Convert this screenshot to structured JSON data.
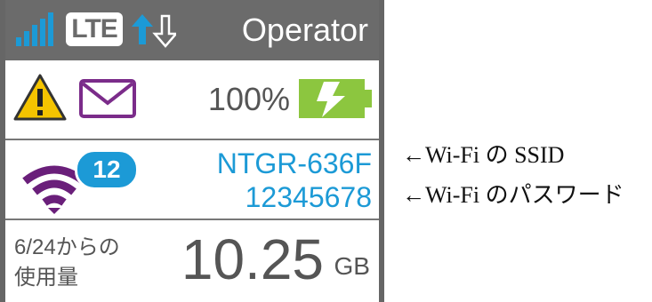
{
  "status_bar": {
    "network_type": "LTE",
    "operator": "Operator",
    "signal_icon": "signal-bars-icon",
    "data_arrows_icon": "up-down-arrows-icon",
    "colors": {
      "background": "#6b6b6b",
      "signal": "#1c9ad6"
    }
  },
  "alerts": {
    "warning_icon": "warning-icon",
    "message_icon": "mail-icon",
    "battery_percent": "100%",
    "battery_icon": "battery-charging-icon",
    "colors": {
      "warning": "#f5c400",
      "mail": "#7b2c8a",
      "battery": "#8cc63f"
    }
  },
  "wifi": {
    "icon": "wifi-icon",
    "connected_clients": "12",
    "ssid": "NTGR-636F",
    "password": "12345678",
    "colors": {
      "wifi": "#6a1f7a",
      "accent": "#1c9ad6"
    }
  },
  "usage": {
    "label_line1": "6/24からの",
    "label_line2": "使用量",
    "value": "10.25",
    "unit": "GB"
  },
  "annotations": {
    "ssid": "←Wi-Fi の SSID",
    "password": "←Wi-Fi のパスワード"
  }
}
